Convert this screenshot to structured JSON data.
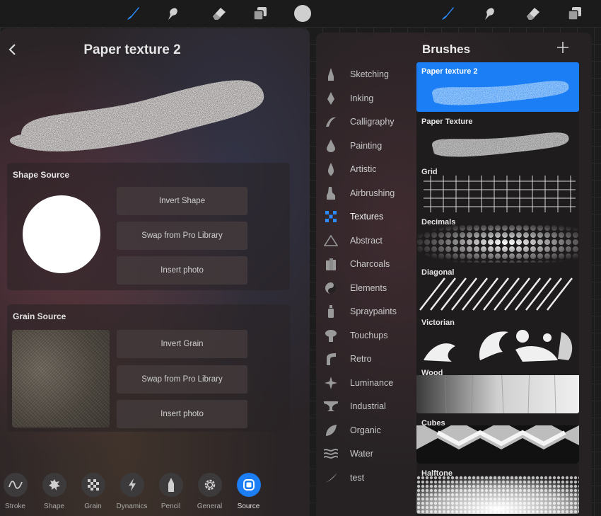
{
  "colors": {
    "accent": "#1b7ef5",
    "panel": "#2a2426",
    "toolbar": "#1b1b1b"
  },
  "toolbar": {
    "left_icons": [
      "brush-icon",
      "smudge-icon",
      "eraser-icon",
      "layers-icon",
      "color-icon"
    ],
    "right_icons": [
      "brush-icon",
      "smudge-icon",
      "eraser-icon",
      "layers-icon"
    ]
  },
  "studio": {
    "title": "Paper texture 2",
    "shape_source": {
      "title": "Shape Source",
      "buttons": [
        "Invert Shape",
        "Swap from Pro Library",
        "Insert photo"
      ]
    },
    "grain_source": {
      "title": "Grain Source",
      "buttons": [
        "Invert Grain",
        "Swap from Pro Library",
        "Insert photo"
      ]
    },
    "tabs": [
      {
        "label": "Stroke",
        "icon": "stroke-icon"
      },
      {
        "label": "Shape",
        "icon": "shape-icon"
      },
      {
        "label": "Grain",
        "icon": "grain-icon"
      },
      {
        "label": "Dynamics",
        "icon": "dynamics-icon"
      },
      {
        "label": "Pencil",
        "icon": "pencil-icon"
      },
      {
        "label": "General",
        "icon": "general-icon"
      },
      {
        "label": "Source",
        "icon": "source-icon",
        "active": true
      }
    ]
  },
  "library": {
    "title": "Brushes",
    "categories": [
      "Sketching",
      "Inking",
      "Calligraphy",
      "Painting",
      "Artistic",
      "Airbrushing",
      "Textures",
      "Abstract",
      "Charcoals",
      "Elements",
      "Spraypaints",
      "Touchups",
      "Retro",
      "Luminance",
      "Industrial",
      "Organic",
      "Water",
      "test"
    ],
    "active_category": "Textures",
    "brushes": [
      "Paper texture 2",
      "Paper Texture",
      "Grid",
      "Decimals",
      "Diagonal",
      "Victorian",
      "Wood",
      "Cubes",
      "Halftone"
    ],
    "selected_brush": "Paper texture 2"
  }
}
